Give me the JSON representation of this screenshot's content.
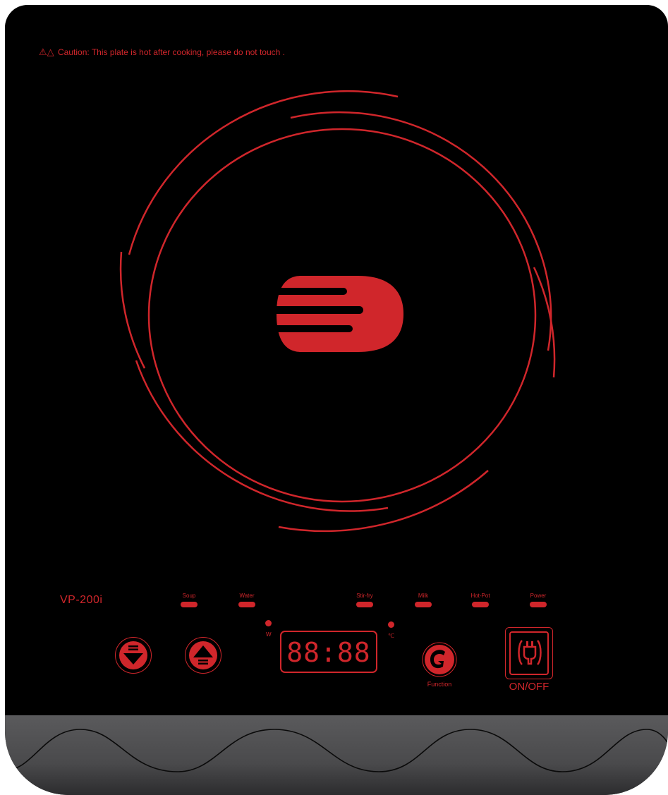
{
  "caution": {
    "icon": "warning-triangle-icons",
    "text": "Caution: This plate is hot after cooking, please do not touch ."
  },
  "model": "VP-200i",
  "modes": [
    {
      "label": "Soup"
    },
    {
      "label": "Water"
    },
    {
      "label": "Stir-fry"
    },
    {
      "label": "Milk"
    },
    {
      "label": "Hot-Pot"
    },
    {
      "label": "Power"
    }
  ],
  "units": {
    "watt": "W",
    "celsius": "℃"
  },
  "display": {
    "text": "88:88"
  },
  "buttons": {
    "down": {
      "icon": "arrow-down-icon"
    },
    "up": {
      "icon": "arrow-up-icon"
    },
    "function": {
      "icon": "function-g-icon",
      "label": "Function"
    },
    "power": {
      "icon": "power-plug-icon",
      "label": "ON/OFF"
    }
  },
  "colors": {
    "accent": "#d0262b",
    "panel": "#000000",
    "band": "#4a4a4c"
  }
}
